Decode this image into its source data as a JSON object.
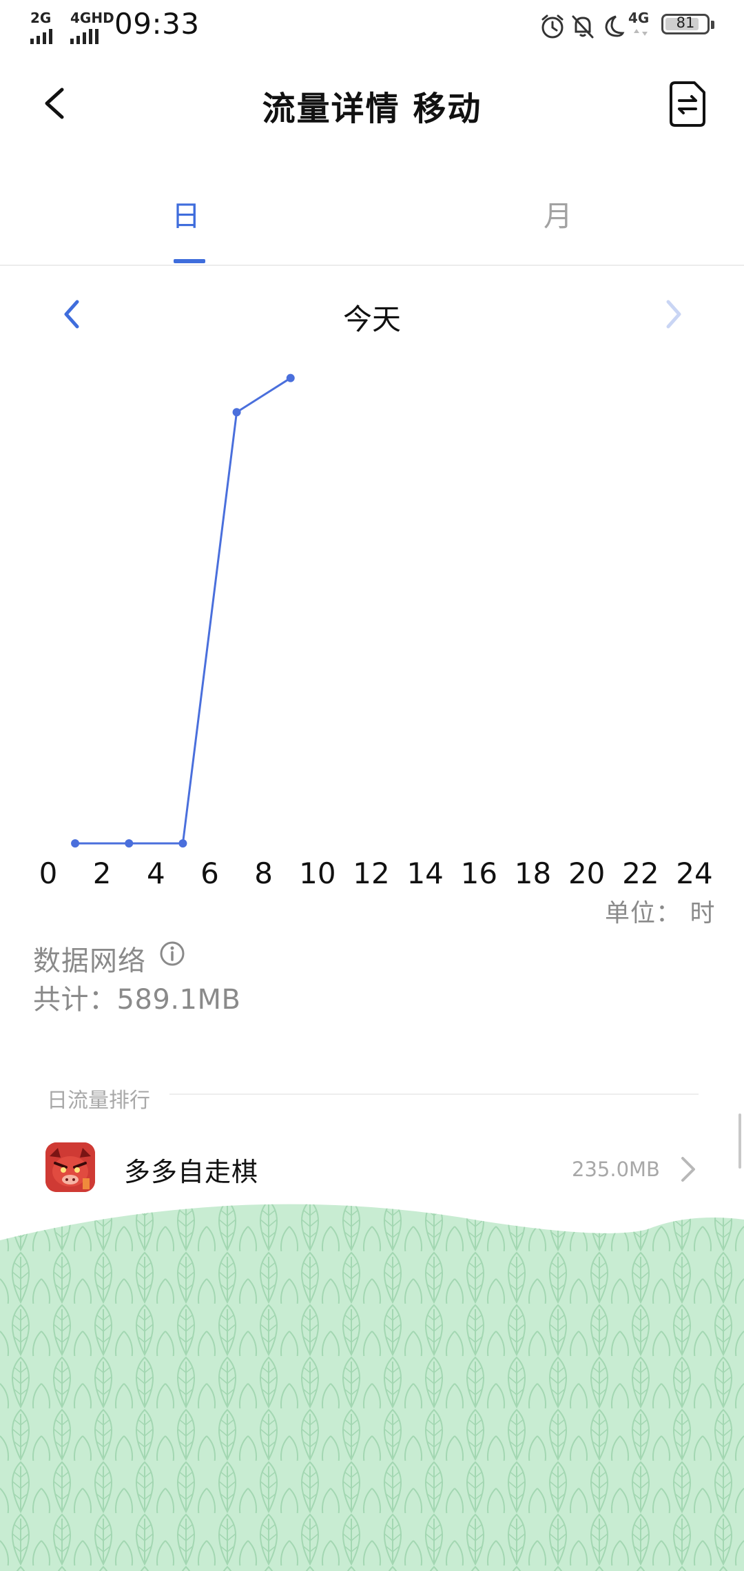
{
  "status_bar": {
    "network_1": "2G",
    "network_2": "4GHD",
    "time": "09:33",
    "network_3": "4G",
    "battery": "81"
  },
  "header": {
    "title": "流量详情 移动"
  },
  "tabs": [
    {
      "label": "日",
      "active": true
    },
    {
      "label": "月",
      "active": false
    }
  ],
  "date_nav": {
    "label": "今天"
  },
  "chart_data": {
    "type": "line",
    "x": [
      1,
      3,
      5,
      7,
      9
    ],
    "y": [
      0,
      0,
      0,
      480,
      518
    ],
    "xlim": [
      0,
      24
    ],
    "ylim": [
      0,
      540
    ],
    "x_ticks": [
      "0",
      "2",
      "4",
      "6",
      "8",
      "10",
      "12",
      "14",
      "16",
      "18",
      "20",
      "22",
      "24"
    ],
    "unit_label": "单位： 时",
    "color": "#4a6fdc"
  },
  "summary": {
    "network_label": "数据网络",
    "total_text": "共计：589.1MB"
  },
  "ranking": {
    "title": "日流量排行",
    "apps": [
      {
        "name": "多多自走棋",
        "size": "235.0MB"
      }
    ]
  },
  "colors": {
    "accent": "#3f6ddc",
    "leaf_bg": "#c7ebd1",
    "leaf_line": "#9dd3ad"
  }
}
